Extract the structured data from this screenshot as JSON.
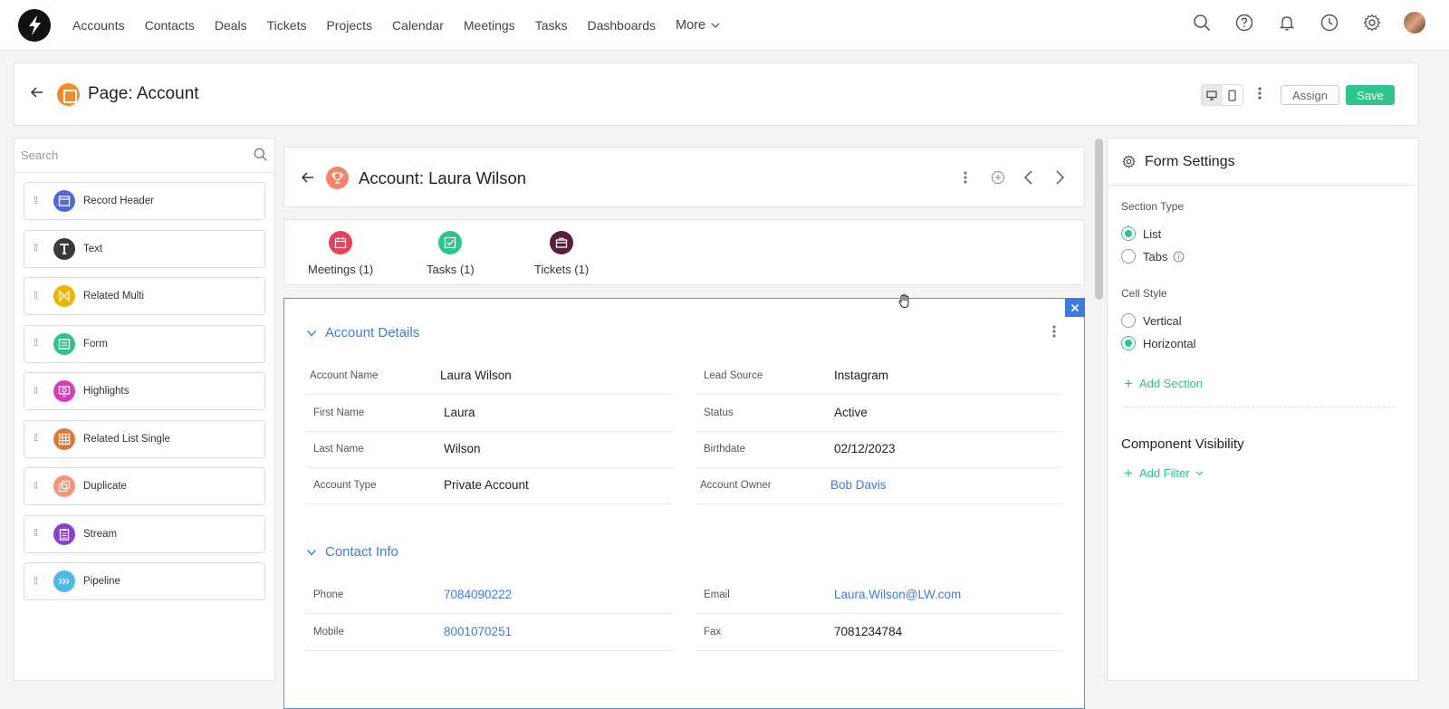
{
  "nav": {
    "items": [
      "Accounts",
      "Contacts",
      "Deals",
      "Tickets",
      "Projects",
      "Calendar",
      "Meetings",
      "Tasks",
      "Dashboards"
    ],
    "more_label": "More"
  },
  "page": {
    "title": "Page: Account",
    "assign_label": "Assign",
    "save_label": "Save"
  },
  "left": {
    "search_placeholder": "Search",
    "components": [
      {
        "label": "Record Header",
        "icon": "record-header-icon",
        "color": "#5566d6"
      },
      {
        "label": "Text",
        "icon": "text-icon",
        "color": "#3a3a3a"
      },
      {
        "label": "Related Multi",
        "icon": "related-multi-icon",
        "color": "#f0b400"
      },
      {
        "label": "Form",
        "icon": "form-icon",
        "color": "#2ec48a"
      },
      {
        "label": "Highlights",
        "icon": "highlights-icon",
        "color": "#d63db6"
      },
      {
        "label": "Related List Single",
        "icon": "related-list-icon",
        "color": "#e0783c"
      },
      {
        "label": "Duplicate",
        "icon": "duplicate-icon",
        "color": "#f4957a"
      },
      {
        "label": "Stream",
        "icon": "stream-icon",
        "color": "#8a3fd1"
      },
      {
        "label": "Pipeline",
        "icon": "pipeline-icon",
        "color": "#4fb8ea"
      }
    ]
  },
  "record": {
    "title": "Account: Laura Wilson",
    "related": [
      {
        "label": "Meetings (1)",
        "icon": "calendar-icon",
        "color": "#e8415c"
      },
      {
        "label": "Tasks (1)",
        "icon": "checkbox-icon",
        "color": "#2ec48a"
      },
      {
        "label": "Tickets (1)",
        "icon": "ticket-icon",
        "color": "#5a1f3c"
      }
    ],
    "sections": [
      {
        "title": "Account Details",
        "left": [
          {
            "label": "Account Name",
            "value": "Laura Wilson"
          },
          {
            "label": "First Name",
            "value": "Laura"
          },
          {
            "label": "Last Name",
            "value": "Wilson"
          },
          {
            "label": "Account Type",
            "value": "Private Account"
          }
        ],
        "right": [
          {
            "label": "Lead Source",
            "value": "Instagram"
          },
          {
            "label": "Status",
            "value": "Active"
          },
          {
            "label": "Birthdate",
            "value": "02/12/2023"
          },
          {
            "label": "Account Owner",
            "value": "Bob Davis"
          }
        ]
      },
      {
        "title": "Contact Info",
        "left": [
          {
            "label": "Phone",
            "value": "7084090222"
          },
          {
            "label": "Mobile",
            "value": "8001070251"
          }
        ],
        "right": [
          {
            "label": "Email",
            "value": "Laura.Wilson@LW.com"
          },
          {
            "label": "Fax",
            "value": "7081234784"
          }
        ]
      }
    ]
  },
  "settings": {
    "title": "Form Settings",
    "section_type_label": "Section Type",
    "section_type_options": [
      "List",
      "Tabs"
    ],
    "section_type_selected": "List",
    "cell_style_label": "Cell Style",
    "cell_style_options": [
      "Vertical",
      "Horizontal"
    ],
    "cell_style_selected": "Horizontal",
    "add_section_label": "Add Section",
    "visibility_title": "Component Visibility",
    "add_filter_label": "Add Filter"
  },
  "colors": {
    "accent_green": "#2ec48a",
    "link_blue": "#3d7be3",
    "page_icon_orange": "#f28b2b",
    "trophy_salmon": "#f4856b"
  }
}
